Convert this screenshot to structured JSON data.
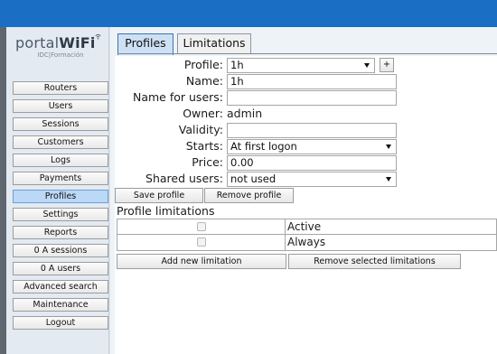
{
  "app": {
    "brand_light": "portal",
    "brand_bold": "WiFi",
    "subtitle": "IDC|Formación",
    "accent_color": "#1a6fc4"
  },
  "sidebar": {
    "items": [
      {
        "label": "Routers"
      },
      {
        "label": "Users"
      },
      {
        "label": "Sessions"
      },
      {
        "label": "Customers"
      },
      {
        "label": "Logs"
      },
      {
        "label": "Payments"
      },
      {
        "label": "Profiles",
        "active": true
      },
      {
        "label": "Settings"
      },
      {
        "label": "Reports"
      },
      {
        "label": "0 A sessions"
      },
      {
        "label": "0 A users"
      },
      {
        "label": "Advanced search"
      },
      {
        "label": "Maintenance"
      },
      {
        "label": "Logout"
      }
    ]
  },
  "tabs": [
    {
      "label": "Profiles",
      "active": true
    },
    {
      "label": "Limitations",
      "active": false
    }
  ],
  "form": {
    "profile": {
      "label": "Profile:",
      "value": "1h",
      "add_button": "+"
    },
    "name": {
      "label": "Name:",
      "value": "1h"
    },
    "name_for_users": {
      "label": "Name for users:",
      "value": ""
    },
    "owner": {
      "label": "Owner:",
      "value": "admin"
    },
    "validity": {
      "label": "Validity:",
      "value": ""
    },
    "starts": {
      "label": "Starts:",
      "value": "At first logon"
    },
    "price": {
      "label": "Price:",
      "value": "0.00"
    },
    "shared_users": {
      "label": "Shared users:",
      "value": "not used"
    }
  },
  "actions": {
    "save_profile": "Save profile",
    "remove_profile": "Remove profile"
  },
  "limitations": {
    "title": "Profile limitations",
    "rows": [
      {
        "label": "Active",
        "checked": false
      },
      {
        "label": "Always",
        "checked": false
      }
    ],
    "add_button": "Add new limitation",
    "remove_button": "Remove selected limitations"
  }
}
